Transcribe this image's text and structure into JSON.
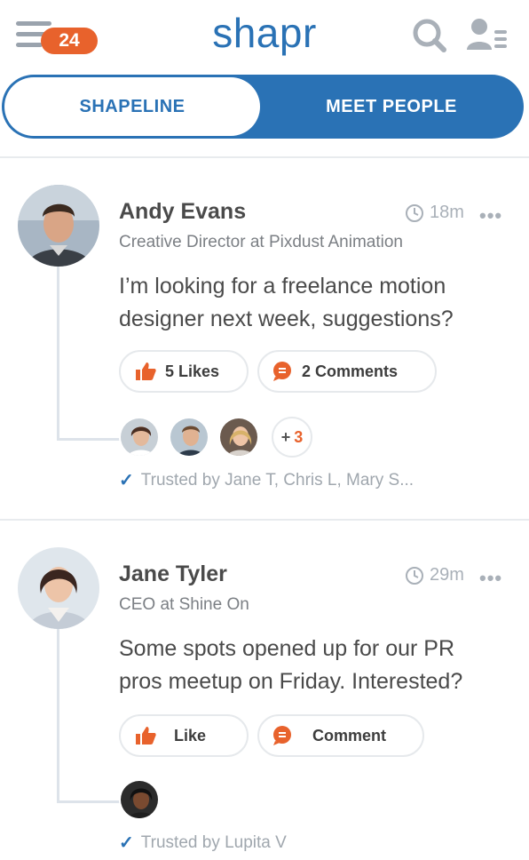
{
  "header": {
    "logo": "shapr",
    "menu_badge": "24",
    "menu_icon": "hamburger-icon",
    "search_icon": "search-icon",
    "profile_icon": "profile-list-icon"
  },
  "tabs": [
    {
      "label": "SHAPELINE",
      "active": false
    },
    {
      "label": "MEET PEOPLE",
      "active": true
    }
  ],
  "colors": {
    "brand_blue": "#2a72b5",
    "accent_orange": "#e8622c",
    "line_gray": "#dde3ea"
  },
  "posts": [
    {
      "name": "Andy Evans",
      "role": "Creative Director at Pixdust Animation",
      "time": "18m",
      "more": "•••",
      "text": "I’m looking for a freelance motion designer next week, suggestions?",
      "likes_label": "5 Likes",
      "comments_label": "2 Comments",
      "extra_trusted": "3",
      "trusted_text": "Trusted by Jane T, Chris L, Mary S..."
    },
    {
      "name": "Jane Tyler",
      "role": "CEO at Shine On",
      "time": "29m",
      "more": "•••",
      "text": "Some spots opened up for our PR pros meetup on Friday. Interested?",
      "likes_label": "Like",
      "comments_label": "Comment",
      "trusted_text": "Trusted by Lupita V"
    }
  ]
}
